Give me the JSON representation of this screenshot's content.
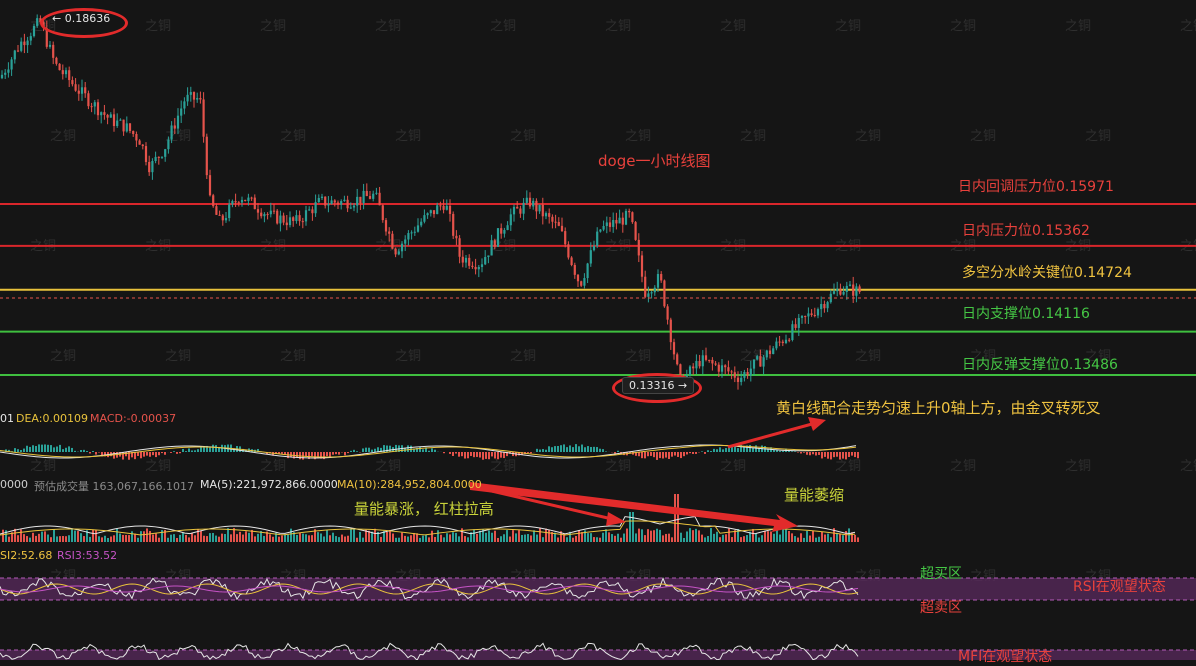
{
  "chart_title": "doge一小时线图",
  "high_marker": "← 0.18636",
  "low_marker": "0.13316 →",
  "levels": [
    {
      "label": "日内回调压力位0.15971",
      "price": 0.15971,
      "color": "#d9262b"
    },
    {
      "label": "日内压力位0.15362",
      "price": 0.15362,
      "color": "#d9262b"
    },
    {
      "label": "多空分水岭关键位0.14724",
      "price": 0.14724,
      "color": "#e8c23c"
    },
    {
      "label": "日内支撑位0.14116",
      "price": 0.14116,
      "color": "#3fbf3f"
    },
    {
      "label": "日内反弹支撑位0.13486",
      "price": 0.13486,
      "color": "#3fbf3f"
    }
  ],
  "macd": {
    "dif_partial": "01",
    "dea": "DEA:0.00109",
    "macd": "MACD:-0.00037",
    "note": "黄白线配合走势匀速上升0轴上方，由金叉转死叉"
  },
  "volume": {
    "vol_partial": "0000",
    "est": "预估成交量 163,067,166.1017",
    "ma5": "MA(5):221,972,866.0000",
    "ma10": "MA(10):284,952,804.0000",
    "note_left": "量能暴涨，  红柱拉高",
    "note_right": "量能萎缩"
  },
  "rsi": {
    "rsi2": "SI2:52.68",
    "rsi3": "RSI3:53.52",
    "overbought": "超买区",
    "oversold": "超卖区",
    "status": "RSI在观望状态"
  },
  "mfi": {
    "status": "MFI在观望状态"
  },
  "watermark": "之铜",
  "colors": {
    "up": "#2aa198",
    "down": "#e5534b",
    "bg": "#151515"
  }
}
